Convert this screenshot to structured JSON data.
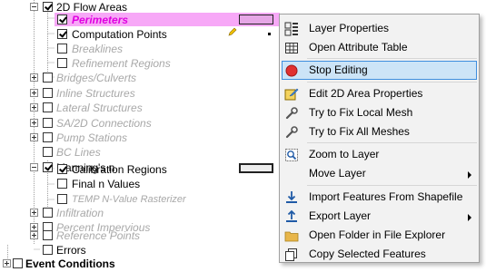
{
  "tree": {
    "items": [
      {
        "label": "2D Flow Areas"
      },
      {
        "label": "Perimeters"
      },
      {
        "label": "Computation Points"
      },
      {
        "label": "Breaklines"
      },
      {
        "label": "Refinement Regions"
      },
      {
        "label": "Bridges/Culverts"
      },
      {
        "label": "Inline Structures"
      },
      {
        "label": "Lateral Structures"
      },
      {
        "label": "SA/2D Connections"
      },
      {
        "label": "Pump Stations"
      },
      {
        "label": "BC Lines"
      },
      {
        "label": "Manning's n"
      },
      {
        "label": "Calibration Regions"
      },
      {
        "label": "Final n Values"
      },
      {
        "label": "TEMP N-Value Rasterizer"
      },
      {
        "label": "Infiltration"
      },
      {
        "label": "Percent Impervious"
      },
      {
        "label": "Reference Points"
      },
      {
        "label": "Errors"
      },
      {
        "label": "Event Conditions"
      }
    ]
  },
  "context_menu": {
    "items": [
      {
        "label": "Layer Properties",
        "icon": "layer-properties-icon"
      },
      {
        "label": "Open Attribute Table",
        "icon": "table-icon"
      },
      {
        "label": "Stop Editing",
        "icon": "stop-record-icon"
      },
      {
        "label": "Edit 2D Area Properties",
        "icon": "edit-properties-icon"
      },
      {
        "label": "Try to Fix Local Mesh",
        "icon": "wrench-icon"
      },
      {
        "label": "Try to Fix All Meshes",
        "icon": "wrench-icon"
      },
      {
        "label": "Zoom to Layer",
        "icon": "zoom-icon"
      },
      {
        "label": "Move Layer"
      },
      {
        "label": "Import Features From Shapefile",
        "icon": "import-icon"
      },
      {
        "label": "Export Layer",
        "icon": "export-icon"
      },
      {
        "label": "Open Folder in File Explorer",
        "icon": "folder-icon"
      },
      {
        "label": "Copy Selected Features",
        "icon": "copy-icon"
      }
    ]
  },
  "colors": {
    "selection": "#f7a8f7",
    "perimeter_text": "#e000e0",
    "menu_highlight": "#cce4f7",
    "menu_highlight_border": "#3e8ede",
    "stop_icon": "#e03030"
  }
}
